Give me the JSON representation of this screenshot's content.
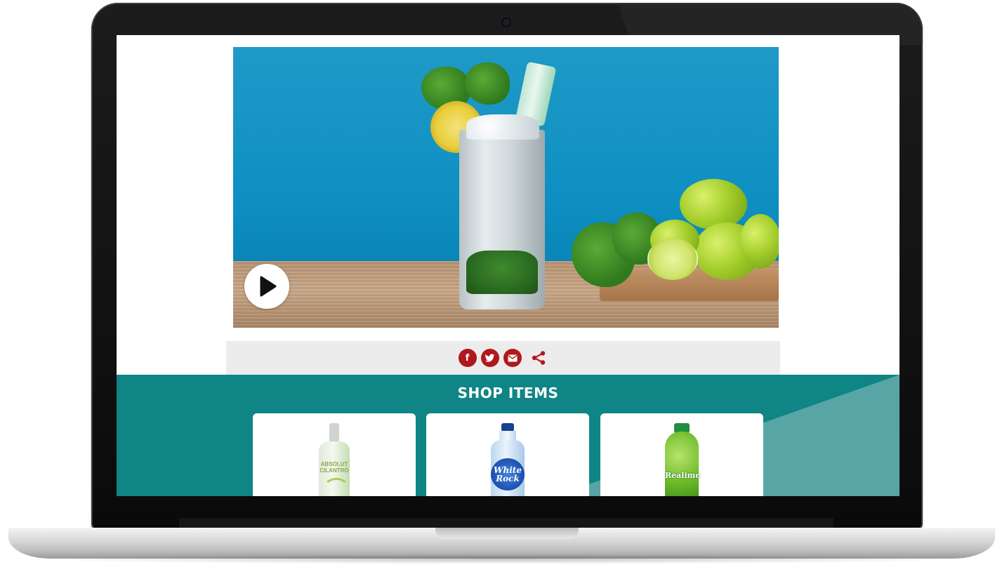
{
  "share": {
    "icons": [
      "facebook-icon",
      "twitter-icon",
      "email-icon",
      "share-icon"
    ],
    "facebook_glyph": "f",
    "color": "#b1181c"
  },
  "shop": {
    "title": "SHOP ITEMS",
    "background": "#0f8585",
    "products": [
      {
        "label": "ABSOLUT CILANTRO"
      },
      {
        "label": "White Rock"
      },
      {
        "label": "Realime"
      }
    ]
  },
  "hero": {
    "play_icon": "play-icon"
  }
}
